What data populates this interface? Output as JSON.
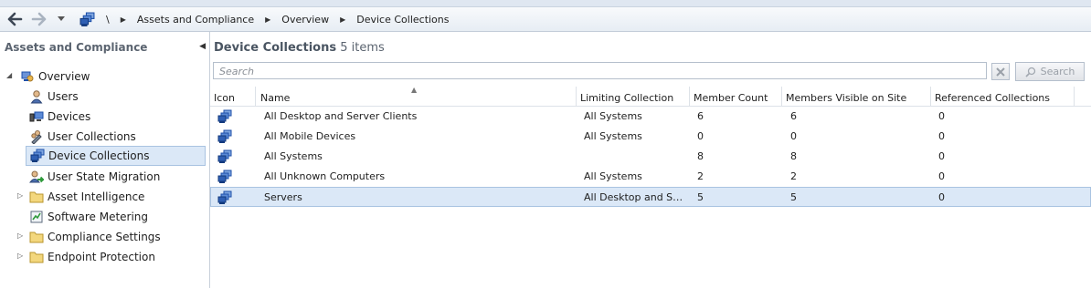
{
  "nav": {
    "root_label": "\\",
    "breadcrumbs": [
      "Assets and Compliance",
      "Overview",
      "Device Collections"
    ]
  },
  "left": {
    "header": "Assets and Compliance",
    "tree": {
      "overview": "Overview",
      "users": "Users",
      "devices": "Devices",
      "user_collections": "User Collections",
      "device_collections": "Device Collections",
      "user_state_migration": "User State Migration",
      "asset_intelligence": "Asset Intelligence",
      "software_metering": "Software Metering",
      "compliance_settings": "Compliance Settings",
      "endpoint_protection": "Endpoint Protection"
    }
  },
  "main": {
    "title": "Device Collections",
    "count_text": "5 items",
    "search_placeholder": "Search",
    "search_button": "Search",
    "columns": [
      "Icon",
      "Name",
      "Limiting Collection",
      "Member Count",
      "Members Visible on Site",
      "Referenced Collections"
    ],
    "rows": [
      {
        "name": "All Desktop and Server Clients",
        "limiting": "All Systems",
        "count": "6",
        "visible": "6",
        "referenced": "0"
      },
      {
        "name": "All Mobile Devices",
        "limiting": "All Systems",
        "count": "0",
        "visible": "0",
        "referenced": "0"
      },
      {
        "name": "All Systems",
        "limiting": "",
        "count": "8",
        "visible": "8",
        "referenced": "0"
      },
      {
        "name": "All Unknown Computers",
        "limiting": "All Systems",
        "count": "2",
        "visible": "2",
        "referenced": "0"
      },
      {
        "name": "Servers",
        "limiting": "All Desktop and Serv...",
        "count": "5",
        "visible": "5",
        "referenced": "0"
      }
    ]
  },
  "colors": {
    "selection_bg": "#dbe8f7",
    "selection_border": "#a9c3e1",
    "collection_icon_blue": "#2f5fb3"
  }
}
